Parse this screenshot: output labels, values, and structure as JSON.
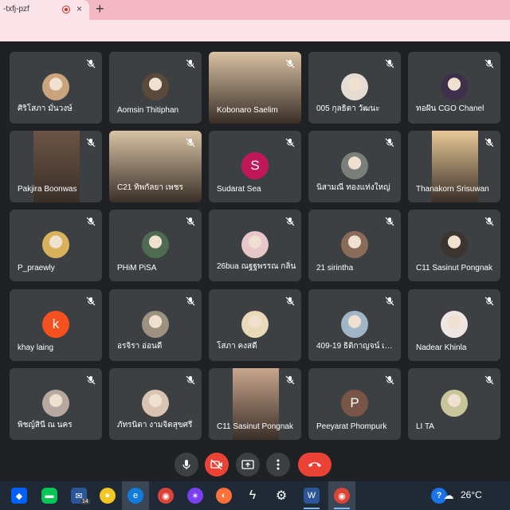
{
  "browser": {
    "tab_title": "-txfj-pzf",
    "tab_close": "×",
    "new_tab": "+"
  },
  "participants": [
    {
      "name": "ศิริโสภา มั่นวงษ์",
      "display": "avatar",
      "color": "#c9a47c"
    },
    {
      "name": "Aomsin Thitiphan",
      "display": "avatar",
      "color": "#5a4a3c"
    },
    {
      "name": "Kobonaro Saelim",
      "display": "video",
      "color": "#d9c2a4"
    },
    {
      "name": "005 กุลธิดา วัฒนะ",
      "display": "avatar",
      "color": "#e6ddd2"
    },
    {
      "name": "ทอฝัน CGO Chanel",
      "display": "avatar",
      "color": "#3e2f4a"
    },
    {
      "name": "Pakjira Boonwas",
      "display": "video",
      "color": "#6b5446"
    },
    {
      "name": "C21 ทิพกัลยา เพชร",
      "display": "video",
      "color": "#d8c3a5"
    },
    {
      "name": "Sudarat Sea",
      "display": "letter",
      "letter": "S",
      "color": "#c2185b"
    },
    {
      "name": "นิสามณี ทองแท่งใหญ่",
      "display": "avatar",
      "color": "#7b7f7a"
    },
    {
      "name": "Thanakorn Srisuwan",
      "display": "video",
      "color": "#e8c998"
    },
    {
      "name": "P_praewly",
      "display": "avatar",
      "color": "#d8b25a"
    },
    {
      "name": "PHiM PiSA",
      "display": "avatar",
      "color": "#4f6b52"
    },
    {
      "name": "26bua ณฐฐพรรณ กลิ่น",
      "display": "avatar",
      "color": "#e7c5c9"
    },
    {
      "name": "21 sirintha",
      "display": "avatar",
      "color": "#8a6a58"
    },
    {
      "name": "C11 Sasinut Pongnak",
      "display": "avatar",
      "color": "#3b3431"
    },
    {
      "name": "khay laing",
      "display": "letter",
      "letter": "k",
      "color": "#f4511e"
    },
    {
      "name": "อรจิรา อ่อนดี",
      "display": "avatar",
      "color": "#9c927f"
    },
    {
      "name": "โสภา คงสดี",
      "display": "avatar",
      "color": "#e9d9b8"
    },
    {
      "name": "409-19 ธิติกาญจน์ เจริญ",
      "display": "avatar",
      "color": "#9fb6c9"
    },
    {
      "name": "Nadear Khinla",
      "display": "avatar",
      "color": "#efe6e4"
    },
    {
      "name": "พิชญ์สินี ณ นคร",
      "display": "avatar",
      "color": "#b7a9a0"
    },
    {
      "name": "ภัทรนิดา งามจิตสุขศรี",
      "display": "avatar",
      "color": "#d9c4b4"
    },
    {
      "name": "C11 Sasinut Pongnak",
      "display": "video",
      "color": "#c9a68d"
    },
    {
      "name": "Peeyarat Phompurk",
      "display": "letter",
      "letter": "P",
      "color": "#795548"
    },
    {
      "name": "LI TA",
      "display": "avatar",
      "color": "#c8c59a"
    }
  ],
  "controls": {
    "mic": "microphone-icon",
    "camera": "camera-off-icon",
    "present": "present-screen-icon",
    "more": "more-options-icon",
    "hangup": "hang-up-icon"
  },
  "taskbar": {
    "mail_badge": "14",
    "temperature": "26°C",
    "help_label": "?"
  }
}
